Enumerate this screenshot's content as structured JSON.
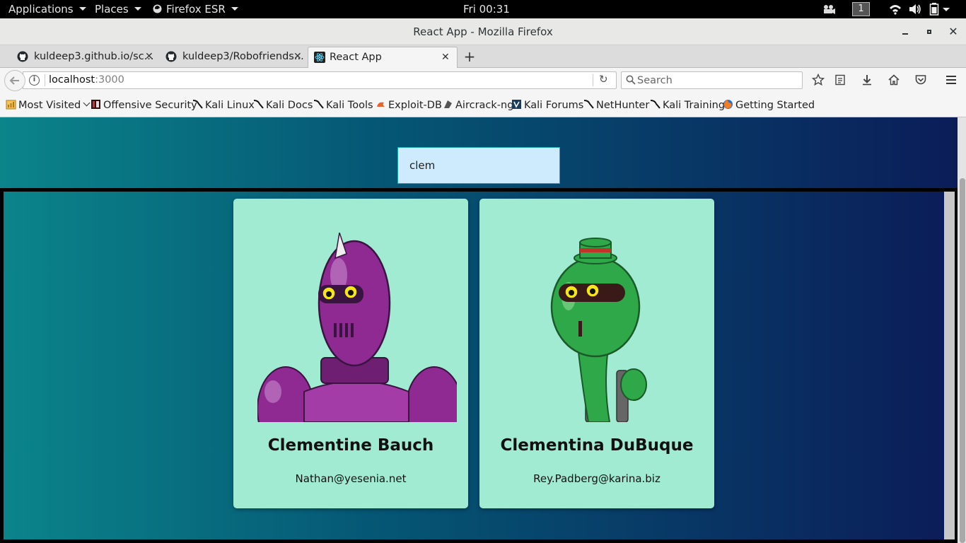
{
  "system_bar": {
    "applications": "Applications",
    "places": "Places",
    "firefox": "Firefox ESR",
    "clock": "Fri 00:31",
    "workspace": "1"
  },
  "window": {
    "title": "React App - Mozilla Firefox"
  },
  "tabs": [
    {
      "label": "kuldeep3.github.io/sc...",
      "icon": "github-icon"
    },
    {
      "label": "kuldeep3/Robofriends...",
      "icon": "github-icon"
    },
    {
      "label": "React App",
      "icon": "react-icon"
    }
  ],
  "nav": {
    "url_host": "localhost",
    "url_port": ":3000",
    "search_placeholder": "Search"
  },
  "bookmarks": [
    {
      "label": "Most Visited",
      "icon": "most-visited-icon"
    },
    {
      "label": "Offensive Security",
      "icon": "offsec-icon"
    },
    {
      "label": "Kali Linux",
      "icon": "kali-icon"
    },
    {
      "label": "Kali Docs",
      "icon": "kali-icon"
    },
    {
      "label": "Kali Tools",
      "icon": "kali-icon"
    },
    {
      "label": "Exploit-DB",
      "icon": "exploitdb-icon"
    },
    {
      "label": "Aircrack-ng",
      "icon": "aircrack-icon"
    },
    {
      "label": "Kali Forums",
      "icon": "kali-forums-icon"
    },
    {
      "label": "NetHunter",
      "icon": "kali-icon"
    },
    {
      "label": "Kali Training",
      "icon": "kali-icon"
    },
    {
      "label": "Getting Started",
      "icon": "firefox-icon"
    }
  ],
  "page": {
    "search_value": "clem",
    "cards": [
      {
        "name": "Clementine Bauch",
        "email": "Nathan@yesenia.net",
        "robot_color": "#8e2a91"
      },
      {
        "name": "Clementina DuBuque",
        "email": "Rey.Padberg@karina.biz",
        "robot_color": "#2fa84a"
      }
    ]
  },
  "colors": {
    "card_bg": "#a1ebd3",
    "search_bg": "#cdebfc",
    "gradient_left": "#0b848a",
    "gradient_right": "#0b1c58"
  }
}
